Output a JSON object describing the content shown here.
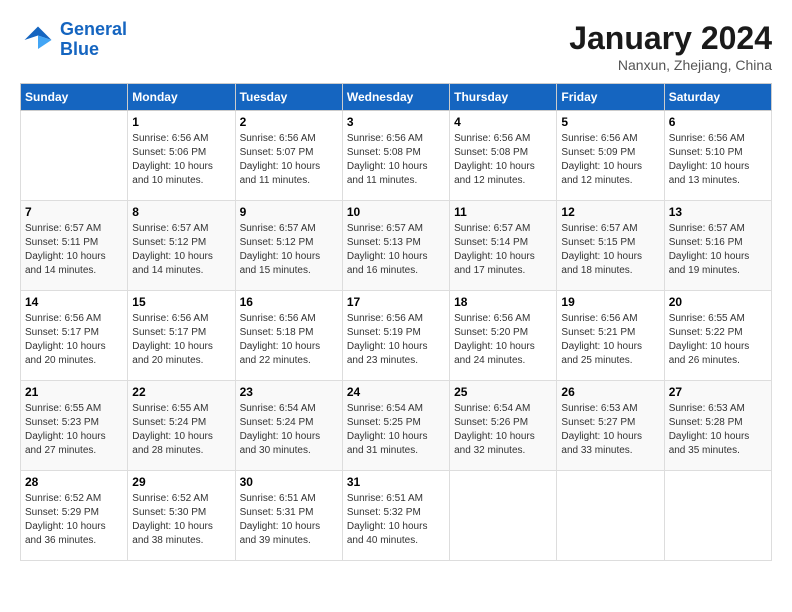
{
  "header": {
    "logo_line1": "General",
    "logo_line2": "Blue",
    "month_year": "January 2024",
    "location": "Nanxun, Zhejiang, China"
  },
  "weekdays": [
    "Sunday",
    "Monday",
    "Tuesday",
    "Wednesday",
    "Thursday",
    "Friday",
    "Saturday"
  ],
  "weeks": [
    [
      {
        "day": "",
        "info": ""
      },
      {
        "day": "1",
        "info": "Sunrise: 6:56 AM\nSunset: 5:06 PM\nDaylight: 10 hours\nand 10 minutes."
      },
      {
        "day": "2",
        "info": "Sunrise: 6:56 AM\nSunset: 5:07 PM\nDaylight: 10 hours\nand 11 minutes."
      },
      {
        "day": "3",
        "info": "Sunrise: 6:56 AM\nSunset: 5:08 PM\nDaylight: 10 hours\nand 11 minutes."
      },
      {
        "day": "4",
        "info": "Sunrise: 6:56 AM\nSunset: 5:08 PM\nDaylight: 10 hours\nand 12 minutes."
      },
      {
        "day": "5",
        "info": "Sunrise: 6:56 AM\nSunset: 5:09 PM\nDaylight: 10 hours\nand 12 minutes."
      },
      {
        "day": "6",
        "info": "Sunrise: 6:56 AM\nSunset: 5:10 PM\nDaylight: 10 hours\nand 13 minutes."
      }
    ],
    [
      {
        "day": "7",
        "info": "Sunrise: 6:57 AM\nSunset: 5:11 PM\nDaylight: 10 hours\nand 14 minutes."
      },
      {
        "day": "8",
        "info": "Sunrise: 6:57 AM\nSunset: 5:12 PM\nDaylight: 10 hours\nand 14 minutes."
      },
      {
        "day": "9",
        "info": "Sunrise: 6:57 AM\nSunset: 5:12 PM\nDaylight: 10 hours\nand 15 minutes."
      },
      {
        "day": "10",
        "info": "Sunrise: 6:57 AM\nSunset: 5:13 PM\nDaylight: 10 hours\nand 16 minutes."
      },
      {
        "day": "11",
        "info": "Sunrise: 6:57 AM\nSunset: 5:14 PM\nDaylight: 10 hours\nand 17 minutes."
      },
      {
        "day": "12",
        "info": "Sunrise: 6:57 AM\nSunset: 5:15 PM\nDaylight: 10 hours\nand 18 minutes."
      },
      {
        "day": "13",
        "info": "Sunrise: 6:57 AM\nSunset: 5:16 PM\nDaylight: 10 hours\nand 19 minutes."
      }
    ],
    [
      {
        "day": "14",
        "info": "Sunrise: 6:56 AM\nSunset: 5:17 PM\nDaylight: 10 hours\nand 20 minutes."
      },
      {
        "day": "15",
        "info": "Sunrise: 6:56 AM\nSunset: 5:17 PM\nDaylight: 10 hours\nand 20 minutes."
      },
      {
        "day": "16",
        "info": "Sunrise: 6:56 AM\nSunset: 5:18 PM\nDaylight: 10 hours\nand 22 minutes."
      },
      {
        "day": "17",
        "info": "Sunrise: 6:56 AM\nSunset: 5:19 PM\nDaylight: 10 hours\nand 23 minutes."
      },
      {
        "day": "18",
        "info": "Sunrise: 6:56 AM\nSunset: 5:20 PM\nDaylight: 10 hours\nand 24 minutes."
      },
      {
        "day": "19",
        "info": "Sunrise: 6:56 AM\nSunset: 5:21 PM\nDaylight: 10 hours\nand 25 minutes."
      },
      {
        "day": "20",
        "info": "Sunrise: 6:55 AM\nSunset: 5:22 PM\nDaylight: 10 hours\nand 26 minutes."
      }
    ],
    [
      {
        "day": "21",
        "info": "Sunrise: 6:55 AM\nSunset: 5:23 PM\nDaylight: 10 hours\nand 27 minutes."
      },
      {
        "day": "22",
        "info": "Sunrise: 6:55 AM\nSunset: 5:24 PM\nDaylight: 10 hours\nand 28 minutes."
      },
      {
        "day": "23",
        "info": "Sunrise: 6:54 AM\nSunset: 5:24 PM\nDaylight: 10 hours\nand 30 minutes."
      },
      {
        "day": "24",
        "info": "Sunrise: 6:54 AM\nSunset: 5:25 PM\nDaylight: 10 hours\nand 31 minutes."
      },
      {
        "day": "25",
        "info": "Sunrise: 6:54 AM\nSunset: 5:26 PM\nDaylight: 10 hours\nand 32 minutes."
      },
      {
        "day": "26",
        "info": "Sunrise: 6:53 AM\nSunset: 5:27 PM\nDaylight: 10 hours\nand 33 minutes."
      },
      {
        "day": "27",
        "info": "Sunrise: 6:53 AM\nSunset: 5:28 PM\nDaylight: 10 hours\nand 35 minutes."
      }
    ],
    [
      {
        "day": "28",
        "info": "Sunrise: 6:52 AM\nSunset: 5:29 PM\nDaylight: 10 hours\nand 36 minutes."
      },
      {
        "day": "29",
        "info": "Sunrise: 6:52 AM\nSunset: 5:30 PM\nDaylight: 10 hours\nand 38 minutes."
      },
      {
        "day": "30",
        "info": "Sunrise: 6:51 AM\nSunset: 5:31 PM\nDaylight: 10 hours\nand 39 minutes."
      },
      {
        "day": "31",
        "info": "Sunrise: 6:51 AM\nSunset: 5:32 PM\nDaylight: 10 hours\nand 40 minutes."
      },
      {
        "day": "",
        "info": ""
      },
      {
        "day": "",
        "info": ""
      },
      {
        "day": "",
        "info": ""
      }
    ]
  ]
}
